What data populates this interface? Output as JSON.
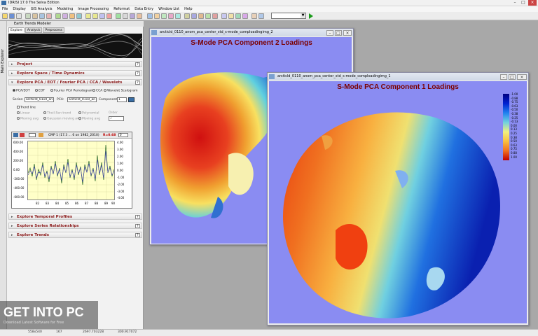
{
  "app": {
    "title": "IDRISI 17.0    The Selva Edition"
  },
  "menu": [
    "File",
    "Display",
    "GIS Analysis",
    "Modeling",
    "Image Processing",
    "Reformat",
    "Data Entry",
    "Window List",
    "Help"
  ],
  "panel": {
    "title": "Earth Trends Modeler",
    "side_tab": "Main Explorer",
    "tabs": [
      "Explore",
      "Analysis",
      "Preprocess"
    ],
    "sections": {
      "project": "Project",
      "space_time": "Explore Space / Time Dynamics",
      "pca": "Explore PCA / EOT / Fourier PCA / CCA / Wavelets",
      "temporal": "Explore Temporal Profiles",
      "relationships": "Explore Series Relationships",
      "trends": "Explore Trends"
    },
    "help_label": "?",
    "methods": [
      "PCA/EOT",
      "EOT",
      "Fourier PCA Periodogram",
      "CCA",
      "Wavelet Scalogram"
    ],
    "series_label": "Series:",
    "series_value": "arcticld_0110_an",
    "pca_label": "PCA:",
    "pca_value": "arcticld_0110_an",
    "component_label": "Component",
    "component_value": "1",
    "trend_line_label": "Trend line",
    "trend_options": [
      "Linear",
      "Theil-Sen trend",
      "Polynomial",
      "Moving avg",
      "Gaussian moving avg",
      "Moving avg"
    ],
    "order_label": "Order",
    "order_value": "2",
    "chart": {
      "header": "CMP 1 (17.3 ... 6 on 1982_2010)",
      "r_label": "R=0.68",
      "spin_value": "0",
      "left_ticks": [
        "600.00",
        "400.00",
        "200.00",
        "0.00",
        "-200.00",
        "-400.00",
        "-600.00"
      ],
      "right_ticks": [
        "4.00",
        "3.00",
        "2.00",
        "1.00",
        "0.00",
        "-1.00",
        "-2.00",
        "-3.00",
        "-4.00"
      ],
      "x_ticks": [
        "82",
        "83",
        "84",
        "85",
        "86",
        "87",
        "88",
        "89",
        "90"
      ]
    }
  },
  "windows": {
    "comp2": {
      "caption": "arcticld_0110_anom_pca_center_std_s-mode_comploadingimg_2",
      "title": "S-Mode PCA Component 2 Loadings"
    },
    "comp1": {
      "caption": "arcticld_0110_anom_pca_center_std_s-mode_comploadingimg_1",
      "title": "S-Mode PCA Component 1 Loadings"
    }
  },
  "legend": {
    "ticks": [
      "-1.00",
      "-0.88",
      "-0.75",
      "-0.63",
      "-0.50",
      "-0.38",
      "-0.25",
      "-0.13",
      "0.00",
      "0.13",
      "0.25",
      "0.38",
      "0.50",
      "0.63",
      "0.75",
      "0.88",
      "1.00"
    ]
  },
  "status": {
    "s1": "558x540",
    "s2": "167",
    "s3": "2697.703228",
    "s4": "300.917072"
  },
  "watermark": {
    "main": "GET INTO PC",
    "sub": "Download Latest Software for Free"
  }
}
